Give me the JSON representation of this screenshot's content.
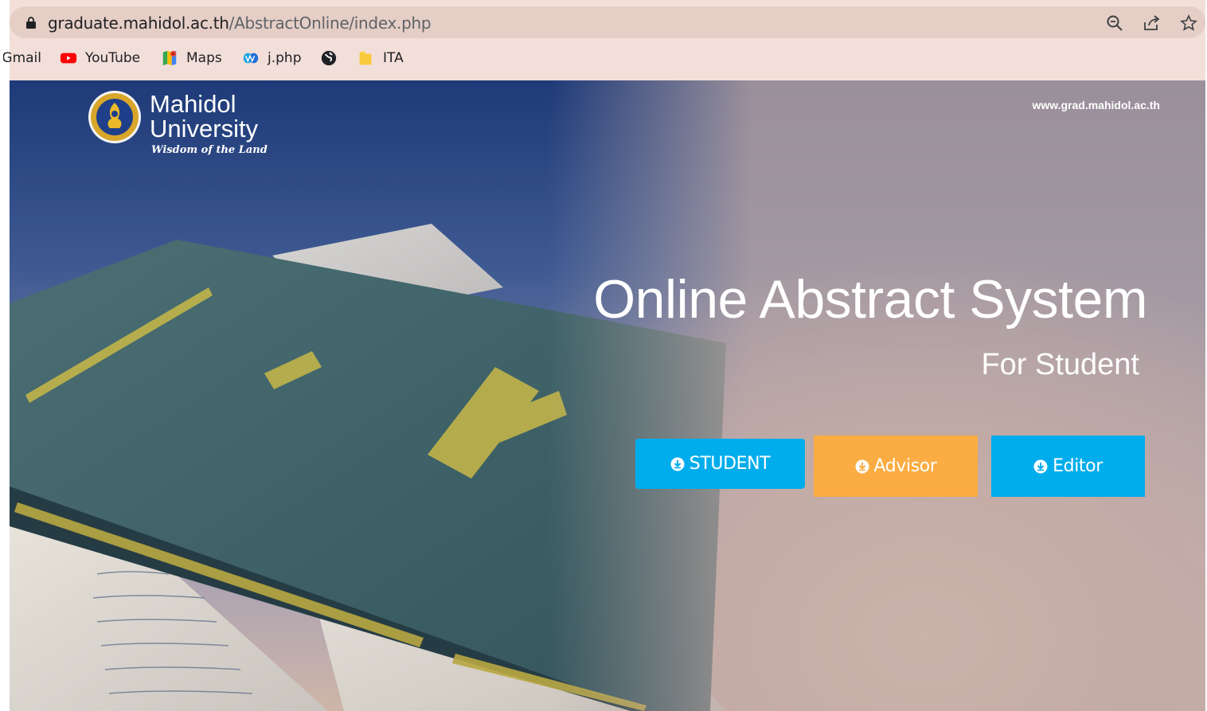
{
  "browser": {
    "url_host": "graduate.mahidol.ac.th",
    "url_path": "/AbstractOnline/index.php",
    "omnibox_icons": [
      "zoom-icon",
      "share-icon",
      "star-icon"
    ],
    "bookmarks": [
      {
        "label": "Gmail",
        "icon": "gmail-icon"
      },
      {
        "label": "YouTube",
        "icon": "youtube-icon"
      },
      {
        "label": "Maps",
        "icon": "maps-icon"
      },
      {
        "label": "j.php",
        "icon": "webex-icon"
      },
      {
        "label": "",
        "icon": "globe-icon"
      },
      {
        "label": "ITA",
        "icon": "folder-icon"
      }
    ]
  },
  "site": {
    "link": "www.grad.mahidol.ac.th",
    "logo": {
      "line1": "Mahidol",
      "line2": "University",
      "tagline": "Wisdom of the Land"
    },
    "headline": "Online Abstract System",
    "subhead": "For Student",
    "buttons": {
      "student": "STUDENT",
      "advisor": "Advisor",
      "editor": "Editor"
    },
    "colors": {
      "primary_button": "#00adec",
      "advisor_button": "#fbac42"
    }
  }
}
